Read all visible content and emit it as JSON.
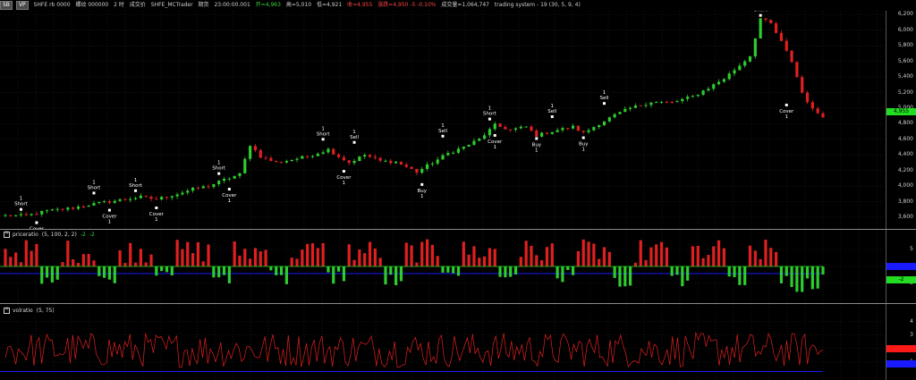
{
  "header": {
    "tags": [
      "SB",
      "VP"
    ],
    "symbol": "SHFE rb 0000",
    "contract": "螺纹 000000",
    "timeframe": "2 时",
    "status": "成交价",
    "source": "SHFE_MCTrader",
    "datetime_label": "期货",
    "time": "23:00:00.001",
    "open": "开=4,963",
    "high": "高=5,010",
    "low": "低=4,921",
    "close": "收=4,955",
    "change": "涨跌=4,950 -5 -0.10%",
    "volume": "成交量=1,064,747",
    "strategy": "trading system - 19 (30, 5, 9, 4)"
  },
  "colors": {
    "bull": "#2ecc2e",
    "bear": "#e02020",
    "grid": "#2a2a2a",
    "axis_text": "#cfcfcf",
    "signal": "#ffffff",
    "blue": "#1a1aff",
    "green_badge": "#22dd22",
    "red_badge": "#ff1a1a",
    "trend_line": "#3355ff"
  },
  "price_axis": {
    "ticks": [
      "6,200",
      "6,000",
      "5,800",
      "5,600",
      "5,400",
      "5,200",
      "5,000",
      "4,800",
      "4,600",
      "4,400",
      "4,200",
      "4,000",
      "3,800",
      "3,600"
    ],
    "last_price": "4,955",
    "range": [
      3450,
      6250
    ]
  },
  "signals": [
    {
      "label": "Short",
      "qty": "1",
      "type": "short",
      "bar": 3,
      "price": 3660
    },
    {
      "label": "Cover",
      "qty": "1",
      "type": "cover",
      "bar": 6,
      "price": 3570
    },
    {
      "label": "Short",
      "qty": "1",
      "type": "short",
      "bar": 17,
      "price": 3870
    },
    {
      "label": "Cover",
      "qty": "1",
      "type": "cover",
      "bar": 20,
      "price": 3730
    },
    {
      "label": "Short",
      "qty": "1",
      "type": "short",
      "bar": 25,
      "price": 3900
    },
    {
      "label": "Cover",
      "qty": "1",
      "type": "cover",
      "bar": 29,
      "price": 3760
    },
    {
      "label": "Short",
      "qty": "1",
      "type": "short",
      "bar": 41,
      "price": 4120
    },
    {
      "label": "Cover",
      "qty": "1",
      "type": "cover",
      "bar": 43,
      "price": 4000
    },
    {
      "label": "Short",
      "qty": "1",
      "type": "short",
      "bar": 61,
      "price": 4560
    },
    {
      "label": "Sell",
      "qty": "1",
      "type": "sell",
      "bar": 67,
      "price": 4520
    },
    {
      "label": "Cover",
      "qty": "1",
      "type": "cover",
      "bar": 65,
      "price": 4230
    },
    {
      "label": "Buy",
      "qty": "1",
      "type": "buy",
      "bar": 80,
      "price": 4060
    },
    {
      "label": "Sell",
      "qty": "1",
      "type": "sell",
      "bar": 84,
      "price": 4600
    },
    {
      "label": "Short",
      "qty": "1",
      "type": "short",
      "bar": 93,
      "price": 4820
    },
    {
      "label": "Cover",
      "qty": "1",
      "type": "cover",
      "bar": 94,
      "price": 4690
    },
    {
      "label": "Sell",
      "qty": "1",
      "type": "sell",
      "bar": 105,
      "price": 4850
    },
    {
      "label": "Buy",
      "qty": "1",
      "type": "buy",
      "bar": 102,
      "price": 4650
    },
    {
      "label": "Buy",
      "qty": "1",
      "type": "buy",
      "bar": 111,
      "price": 4660
    },
    {
      "label": "Sell",
      "qty": "1",
      "type": "sell",
      "bar": 115,
      "price": 5020
    },
    {
      "label": "Short",
      "qty": "1",
      "type": "short",
      "bar": 145,
      "price": 6150
    },
    {
      "label": "Cover",
      "qty": "1",
      "type": "cover",
      "bar": 150,
      "price": 5080
    }
  ],
  "indicator1": {
    "name": "priceratio",
    "params": "(5, 100, 2, 2)",
    "val1": "-2",
    "val2": "-2",
    "ticks": [
      "5",
      "0",
      "-5"
    ],
    "badge_blue": "",
    "badge_green": "-2",
    "range": [
      -10,
      10
    ]
  },
  "indicator2": {
    "name": "volratio",
    "params": "(5, 75)",
    "ticks": [
      "4",
      "3",
      "2",
      "1"
    ],
    "range": [
      -0.2,
      4.5
    ]
  },
  "chart_data": {
    "type": "candlestick",
    "anchors": [
      [
        0,
        3620
      ],
      [
        4,
        3620
      ],
      [
        8,
        3680
      ],
      [
        13,
        3720
      ],
      [
        16,
        3760
      ],
      [
        19,
        3790
      ],
      [
        22,
        3820
      ],
      [
        26,
        3860
      ],
      [
        29,
        3830
      ],
      [
        33,
        3900
      ],
      [
        36,
        3960
      ],
      [
        39,
        4000
      ],
      [
        42,
        4080
      ],
      [
        45,
        4150
      ],
      [
        47,
        4530
      ],
      [
        49,
        4380
      ],
      [
        52,
        4300
      ],
      [
        55,
        4340
      ],
      [
        58,
        4380
      ],
      [
        62,
        4470
      ],
      [
        64,
        4380
      ],
      [
        66,
        4300
      ],
      [
        69,
        4400
      ],
      [
        72,
        4320
      ],
      [
        75,
        4310
      ],
      [
        79,
        4180
      ],
      [
        82,
        4300
      ],
      [
        85,
        4420
      ],
      [
        88,
        4500
      ],
      [
        91,
        4600
      ],
      [
        94,
        4780
      ],
      [
        97,
        4720
      ],
      [
        100,
        4760
      ],
      [
        102,
        4650
      ],
      [
        106,
        4720
      ],
      [
        109,
        4760
      ],
      [
        111,
        4680
      ],
      [
        114,
        4800
      ],
      [
        117,
        4910
      ],
      [
        120,
        5000
      ],
      [
        124,
        5080
      ],
      [
        128,
        5070
      ],
      [
        132,
        5150
      ],
      [
        135,
        5260
      ],
      [
        138,
        5380
      ],
      [
        141,
        5550
      ],
      [
        143,
        5670
      ],
      [
        145,
        6150
      ],
      [
        147,
        6080
      ],
      [
        149,
        5850
      ],
      [
        151,
        5600
      ],
      [
        153,
        5200
      ],
      [
        155,
        4980
      ],
      [
        157,
        4900
      ]
    ],
    "bars": 158
  }
}
